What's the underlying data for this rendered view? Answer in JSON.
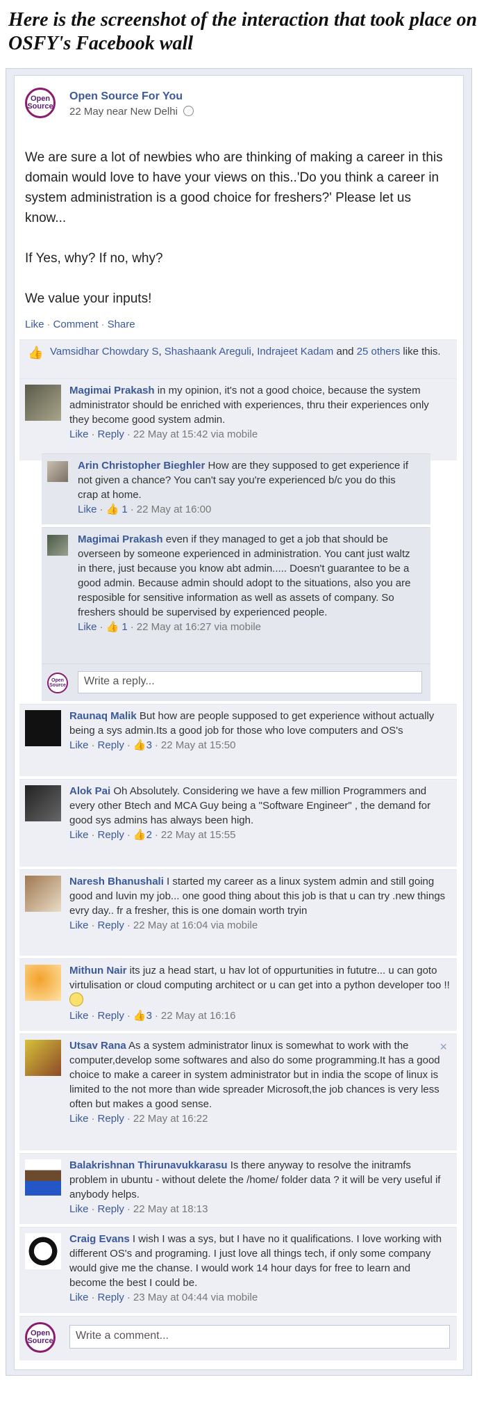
{
  "heading": "Here is the screenshot of the interaction that took place on OSFY's  Facebook wall",
  "post": {
    "page_name": "Open Source For You",
    "meta": "22 May near New Delhi",
    "logo_text_1": "Open",
    "logo_text_2": "Source",
    "paragraph_1": "We are sure a lot of newbies who are thinking of making a career in this domain would love to have your views on this..'Do you think a career in system administration is a good choice for freshers?' Please let us know...",
    "paragraph_2": "If Yes, why? If no, why?",
    "paragraph_3": "We value your inputs!",
    "action_like": "Like",
    "action_comment": "Comment",
    "action_share": "Share"
  },
  "likes": {
    "name_1": "Vamsidhar Chowdary S",
    "name_2": "Shashaank Areguli",
    "name_3": "Indrajeet Kadam",
    "and": "and",
    "others": "25 others",
    "tail": "like this."
  },
  "comments": [
    {
      "author": "Magimai Prakash",
      "text": "in my opinion, it's not a good choice, because the system administrator should be enriched with experiences, thru their experiences only they become good system admin.",
      "meta": "22 May at 15:42 via mobile",
      "likes": ""
    },
    {
      "author": "Raunaq Malik",
      "text": "But how are people supposed to get experience without actually being a sys admin.Its a good job for those who love computers and OS's",
      "meta": "22 May at 15:50",
      "likes": "3"
    },
    {
      "author": "Alok Pai",
      "text": "Oh Absolutely. Considering we have a few million Programmers and every other Btech and MCA Guy being a \"Software Engineer\" , the demand for good sys admins has always been high.",
      "meta": "22 May at 15:55",
      "likes": "2"
    },
    {
      "author": "Naresh Bhanushali",
      "text": "I started my career as a linux system admin and still going good and luvin my job... one good thing about this job is that u can try .new things evry day.. fr a fresher, this is one domain worth tryin",
      "meta": "22 May at 16:04 via mobile",
      "likes": ""
    },
    {
      "author": "Mithun Nair",
      "text": "its juz a head start, u hav lot of oppurtunities in fututre... u can goto virtulisation or cloud computing architect or u can get into a python developer too !!",
      "meta": "22 May at 16:16",
      "likes": "3"
    },
    {
      "author": "Utsav Rana",
      "text": "As a system administrator linux is somewhat to work with the computer,develop some softwares and also do some programming.It has a good choice to make a career in system administrator but in india the scope of linux is limited to the not more than wide spreader Microsoft,the job chances is very less often but makes a good sense.",
      "meta": "22 May at 16:22",
      "likes": ""
    },
    {
      "author": "Balakrishnan Thirunavukkarasu",
      "text": "Is there anyway to resolve the initramfs problem in ubuntu - without delete the /home/ folder data ? it will be very useful if anybody helps.",
      "meta": "22 May at 18:13",
      "likes": ""
    },
    {
      "author": "Craig Evans",
      "text": "I wish I was a sys, but I have no it qualifications. I love working with different OS's and programing. I just love all things tech, if only some company would give me the chanse. I would work 14 hour days for free to learn and become the best I could be.",
      "meta": "23 May at 04:44 via mobile",
      "likes": ""
    }
  ],
  "replies": [
    {
      "author": "Arin Christopher Bieghler",
      "text": "How are they supposed to get experience if not given a chance? You can't say you're experienced b/c you do this crap at home.",
      "meta": "22 May at 16:00",
      "likes": "1"
    },
    {
      "author": "Magimai Prakash",
      "text": "even if they managed to get a job that should be overseen by someone experienced in administration. You cant just waltz in there, just because you know abt admin..... Doesn't guarantee to be a good admin. Because admin should adopt to the situations, also you are resposible for sensitive information as well as assets of company. So freshers should be supervised by experienced people.",
      "meta": "22 May at 16:27 via mobile",
      "likes": "1"
    }
  ],
  "labels": {
    "like": "Like",
    "reply": "Reply",
    "dot": "·",
    "thumb": "👍"
  },
  "inputs": {
    "reply_placeholder": "Write a reply...",
    "comment_placeholder": "Write a comment..."
  },
  "close": "×"
}
